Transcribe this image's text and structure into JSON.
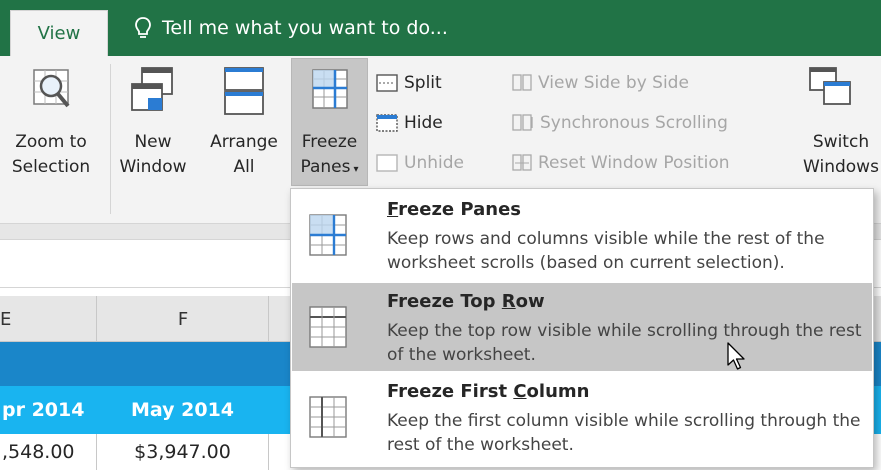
{
  "tabs": {
    "view": "View"
  },
  "tell_me": {
    "text": "Tell me what you want to do..."
  },
  "ribbon": {
    "zoom_to_selection": [
      "Zoom to",
      "Selection"
    ],
    "new_window": [
      "New",
      "Window"
    ],
    "arrange_all": [
      "Arrange",
      "All"
    ],
    "freeze_panes": [
      "Freeze",
      "Panes"
    ],
    "split": "Split",
    "hide": "Hide",
    "unhide": "Unhide",
    "view_side_by_side": "View Side by Side",
    "synchronous_scrolling": "Synchronous Scrolling",
    "reset_window_position": "Reset Window Position",
    "switch_windows": [
      "Switch",
      "Windows"
    ]
  },
  "menu": {
    "items": [
      {
        "title": "Freeze Panes",
        "accel": "F",
        "desc": "Keep rows and columns visible while the rest of the worksheet scrolls (based on current selection)."
      },
      {
        "title": "Freeze Top Row",
        "accel": "R",
        "desc": "Keep the top row visible while scrolling through the rest of the worksheet."
      },
      {
        "title": "Freeze First Column",
        "accel": "C",
        "desc": "Keep the first column visible while scrolling through the rest of the worksheet."
      }
    ]
  },
  "grid": {
    "column_headers": [
      "E",
      "F"
    ],
    "months": [
      "pr 2014",
      "May 2014"
    ],
    "values": [
      ",548.00",
      "$3,947.00"
    ]
  },
  "colors": {
    "accent": "#217346",
    "band_dark": "#1a86c9",
    "band_light": "#19b4f0",
    "hover": "#c6c6c6"
  }
}
